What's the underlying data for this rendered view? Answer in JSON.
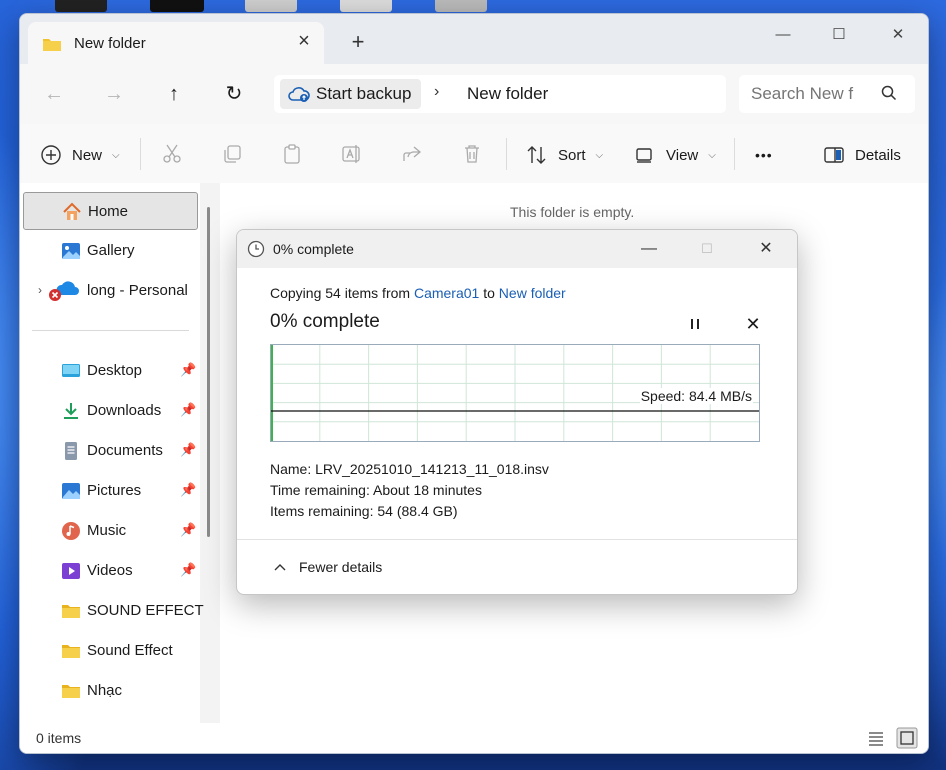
{
  "window": {
    "tab_title": "New folder",
    "minimize": "—",
    "maximize": "☐",
    "close": "✕"
  },
  "address": {
    "backup_label": "Start backup",
    "separator": "›",
    "current_folder": "New folder"
  },
  "search": {
    "placeholder": "Search New f"
  },
  "toolbar": {
    "new_label": "New",
    "sort_label": "Sort",
    "view_label": "View",
    "more": "•••",
    "details_label": "Details"
  },
  "sidebar": {
    "items": [
      {
        "label": "Home",
        "icon": "home-icon"
      },
      {
        "label": "Gallery",
        "icon": "gallery-icon"
      },
      {
        "label": "long - Personal",
        "icon": "onedrive-icon"
      },
      {
        "label": "Desktop",
        "icon": "desktop-icon"
      },
      {
        "label": "Downloads",
        "icon": "downloads-icon"
      },
      {
        "label": "Documents",
        "icon": "documents-icon"
      },
      {
        "label": "Pictures",
        "icon": "pictures-icon"
      },
      {
        "label": "Music",
        "icon": "music-icon"
      },
      {
        "label": "Videos",
        "icon": "videos-icon"
      },
      {
        "label": "SOUND EFFECT",
        "icon": "folder-icon"
      },
      {
        "label": "Sound Effect",
        "icon": "folder-icon"
      },
      {
        "label": "Nhạc",
        "icon": "folder-icon"
      }
    ]
  },
  "content": {
    "empty_message": "This folder is empty."
  },
  "status": {
    "items_count": "0 items"
  },
  "dialog": {
    "title": "0% complete",
    "copy_prefix": "Copying 54 items from",
    "source": "Camera01",
    "to": "to",
    "destination": "New folder",
    "progress_text": "0% complete",
    "progress_percent": 0,
    "speed": "Speed: 84.4 MB/s",
    "name_label": "Name:",
    "name_value": "LRV_20251010_141213_11_018.insv",
    "time_label": "Time remaining:",
    "time_value": "About 18 minutes",
    "items_label": "Items remaining:",
    "items_value": "54 (88.4 GB)",
    "fewer_details": "Fewer details"
  },
  "colors": {
    "accent": "#1a5fb4",
    "graph_grid": "#cfe6d8",
    "graph_progress": "#3cb44b",
    "folder": "#f2c12e"
  }
}
